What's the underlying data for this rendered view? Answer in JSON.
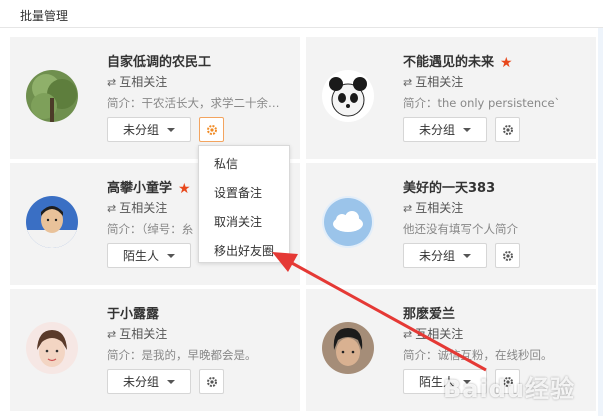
{
  "header": {
    "title": "批量管理"
  },
  "cards": [
    {
      "name": "自家低调的农民工",
      "starred": false,
      "relation": "互相关注",
      "bio": "简介：干农活长大，求学二十余…",
      "group": "未分组"
    },
    {
      "name": "不能遇见的未来",
      "starred": true,
      "relation": "互相关注",
      "bio": "简介：the only persistence`",
      "group": "未分组"
    },
    {
      "name": "高攀小童学",
      "starred": true,
      "relation": "互相关注",
      "bio": "简介：（绰号：糸",
      "group": "陌生人"
    },
    {
      "name": "美好的一天383",
      "starred": false,
      "relation": "互相关注",
      "bio": "他还没有填写个人简介",
      "group": "未分组"
    },
    {
      "name": "于小露露",
      "starred": false,
      "relation": "互相关注",
      "bio": "简介：是我的，早晚都会是。",
      "group": "未分组"
    },
    {
      "name": "那麽爱兰",
      "starred": false,
      "relation": "互相关注",
      "bio": "简介：诚信互粉，在线秒回。",
      "group": "陌生人"
    }
  ],
  "dropdown": {
    "items": [
      "私信",
      "设置备注",
      "取消关注",
      "移出好友圈"
    ]
  },
  "watermark": "Baidu经验",
  "colors": {
    "accent": "#e8481c",
    "gear_active": "#f08a24",
    "arrow": "#e53935"
  },
  "icons": {
    "relation": "mutual-arrows-icon",
    "gear": "gear-icon",
    "star": "star-icon"
  }
}
